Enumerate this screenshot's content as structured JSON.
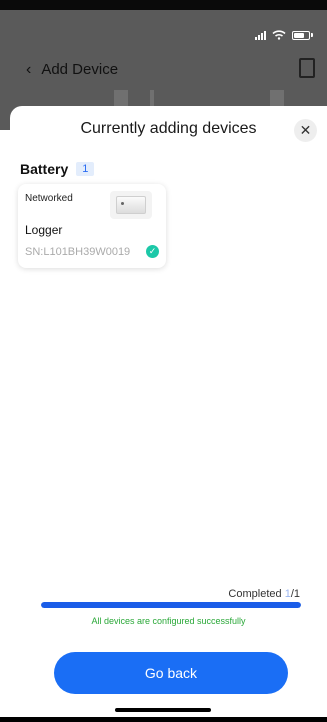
{
  "background": {
    "title": "Add Device"
  },
  "sheet": {
    "title": "Currently adding devices",
    "close_icon": "close-icon"
  },
  "group": {
    "label": "Battery",
    "count": "1"
  },
  "device": {
    "status": "Networked",
    "name": "Logger",
    "sn": "SN:L101BH39W0019",
    "configured": true
  },
  "progress": {
    "label": "Completed ",
    "completed": "1",
    "total_text": "/1",
    "fraction": 1.0
  },
  "success_message": "All devices are configured successfully",
  "go_back_label": "Go back",
  "colors": {
    "accent": "#1a6ef5",
    "progress": "#1a5de8",
    "success": "#2aa838",
    "check": "#1cc8a8"
  }
}
